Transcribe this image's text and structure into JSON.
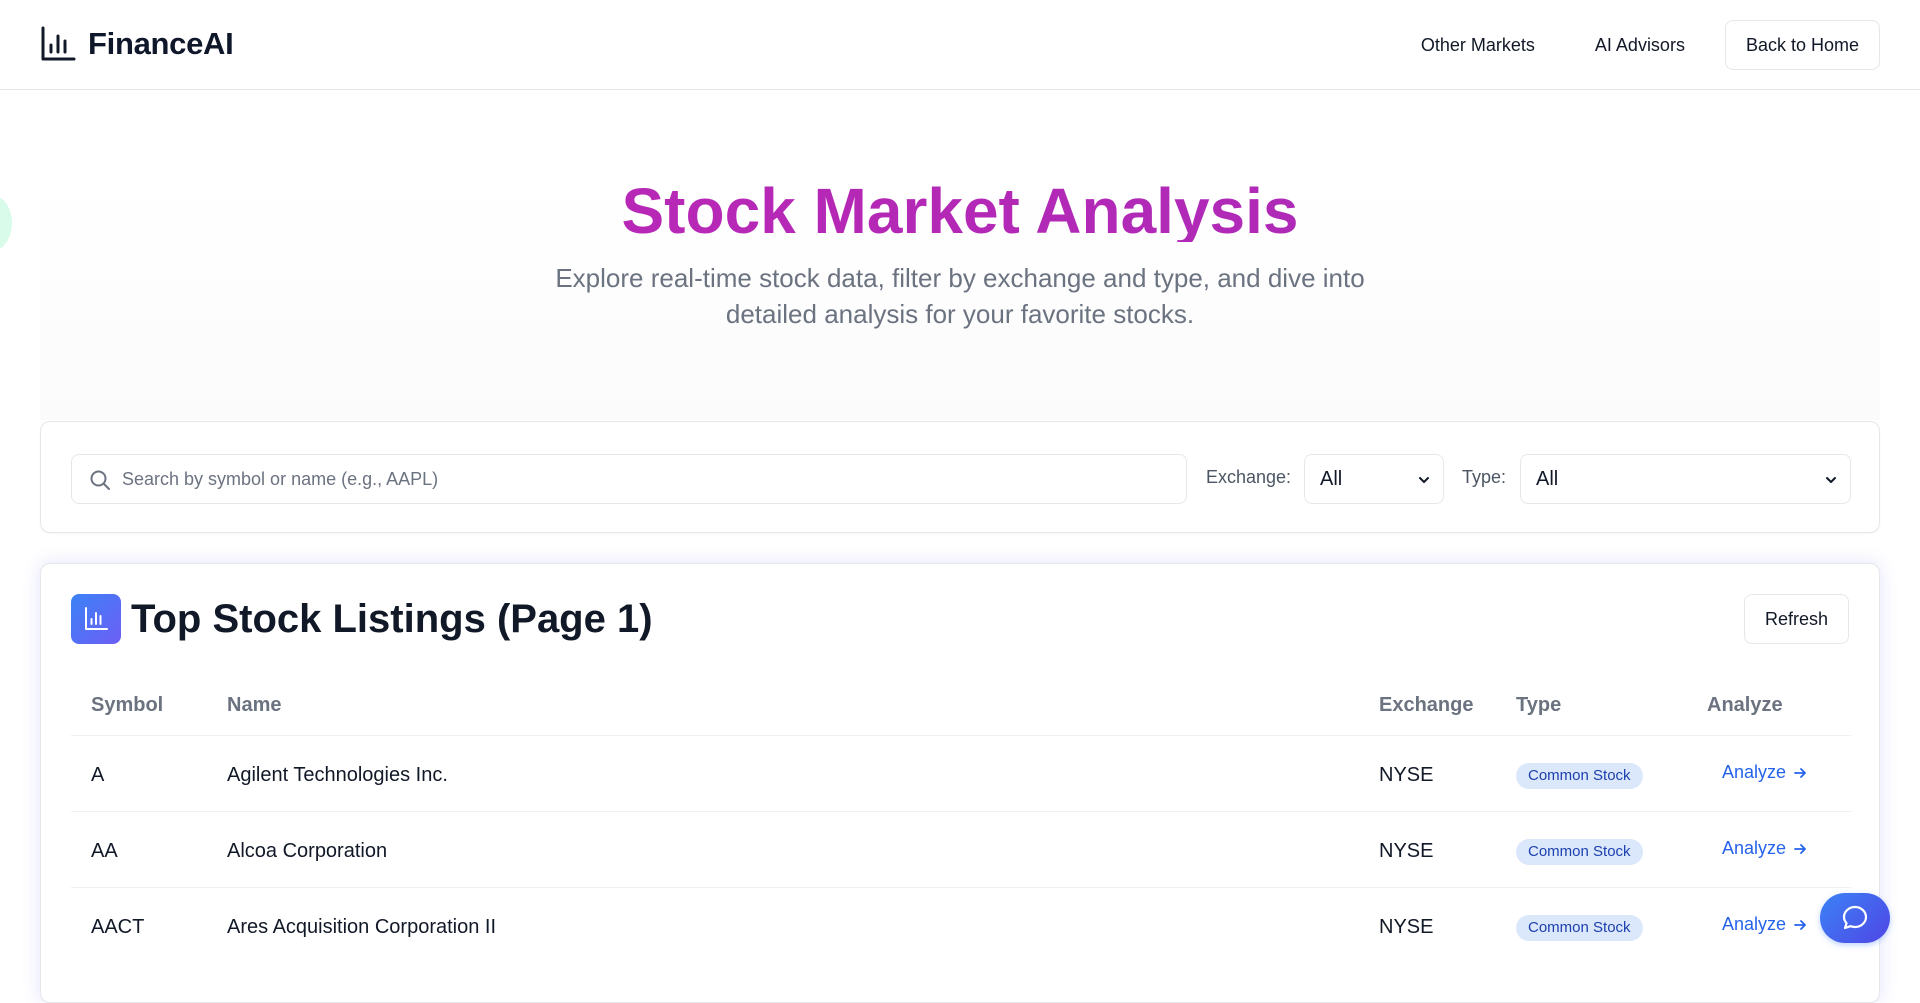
{
  "brand": {
    "name": "FinanceAI",
    "icon": "bar-chart-icon"
  },
  "nav": {
    "items": [
      "Other Markets",
      "AI Advisors"
    ],
    "home_button": "Back to Home"
  },
  "hero": {
    "title": "Stock Market Analysis",
    "subtitle": "Explore real-time stock data, filter by exchange and type, and dive into detailed analysis for your favorite stocks.",
    "title_color": "#c026b5"
  },
  "filters": {
    "search_placeholder": "Search by symbol or name (e.g., AAPL)",
    "exchange_label": "Exchange:",
    "exchange_value": "All",
    "type_label": "Type:",
    "type_value": "All"
  },
  "listings": {
    "title": "Top Stock Listings (Page 1)",
    "refresh_label": "Refresh",
    "columns": [
      "Symbol",
      "Name",
      "Exchange",
      "Type",
      "Analyze"
    ],
    "rows": [
      {
        "symbol": "A",
        "name": "Agilent Technologies Inc.",
        "exchange": "NYSE",
        "type": "Common Stock",
        "action": "Analyze"
      },
      {
        "symbol": "AA",
        "name": "Alcoa Corporation",
        "exchange": "NYSE",
        "type": "Common Stock",
        "action": "Analyze"
      },
      {
        "symbol": "AACT",
        "name": "Ares Acquisition Corporation II",
        "exchange": "NYSE",
        "type": "Common Stock",
        "action": "Analyze"
      }
    ]
  },
  "colors": {
    "accent": "#2563eb",
    "badge_bg": "#dbe8fb",
    "badge_text": "#1e40af"
  }
}
